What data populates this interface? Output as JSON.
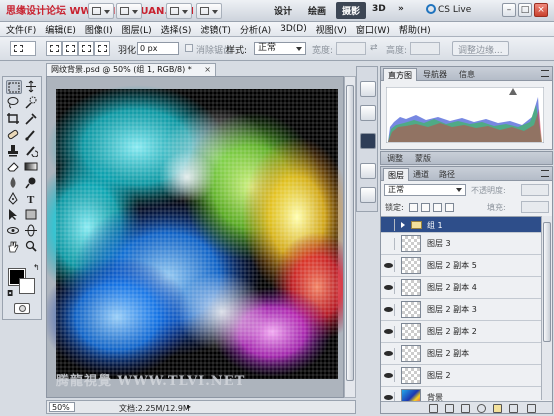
{
  "watermark_top": "思缘设计论坛 WWW.MISSYUAN.COM",
  "workspace": {
    "buttons": [
      "设计",
      "绘画",
      "摄影",
      "3D",
      "»"
    ],
    "active_index": 2,
    "cs_live": "CS Live"
  },
  "menu": [
    "文件(F)",
    "编辑(E)",
    "图像(I)",
    "图层(L)",
    "选择(S)",
    "滤镜(T)",
    "分析(A)",
    "3D(D)",
    "视图(V)",
    "窗口(W)",
    "帮助(H)"
  ],
  "options": {
    "feather_label": "羽化:",
    "feather_value": "0 px",
    "antialias_label": "消除锯齿",
    "style_label": "样式:",
    "style_value": "正常",
    "width_label": "宽度:",
    "height_label": "高度:",
    "refine_edge": "调整边缘..."
  },
  "document": {
    "tab_title": "网纹背景.psd @ 50% (组 1, RGB/8) *",
    "close": "×",
    "watermark": "腾龍視覺 WWW.TLVI.NET",
    "zoom": "50%",
    "doc_info": "文档:2.25M/12.9M"
  },
  "histogram_panel": {
    "tabs": [
      "直方图",
      "导航器",
      "信息"
    ],
    "active_index": 0
  },
  "adjust_panel": {
    "tabs": [
      "调整",
      "蒙版"
    ]
  },
  "layers_panel": {
    "tabs": [
      "图层",
      "通道",
      "路径"
    ],
    "blend_mode": "正常",
    "opacity_label": "不透明度:",
    "lock_label": "锁定:",
    "fill_label": "填充:",
    "layers": [
      {
        "name": "组 1",
        "type": "group",
        "selected": true
      },
      {
        "name": "图层 3",
        "type": "layer"
      },
      {
        "name": "图层 2 副本 5",
        "type": "layer"
      },
      {
        "name": "图层 2 副本 4",
        "type": "layer"
      },
      {
        "name": "图层 2 副本 3",
        "type": "layer"
      },
      {
        "name": "图层 2 副本 2",
        "type": "layer"
      },
      {
        "name": "图层 2 副本",
        "type": "layer"
      },
      {
        "name": "图层 2",
        "type": "layer"
      },
      {
        "name": "背景",
        "type": "gradient"
      }
    ]
  }
}
